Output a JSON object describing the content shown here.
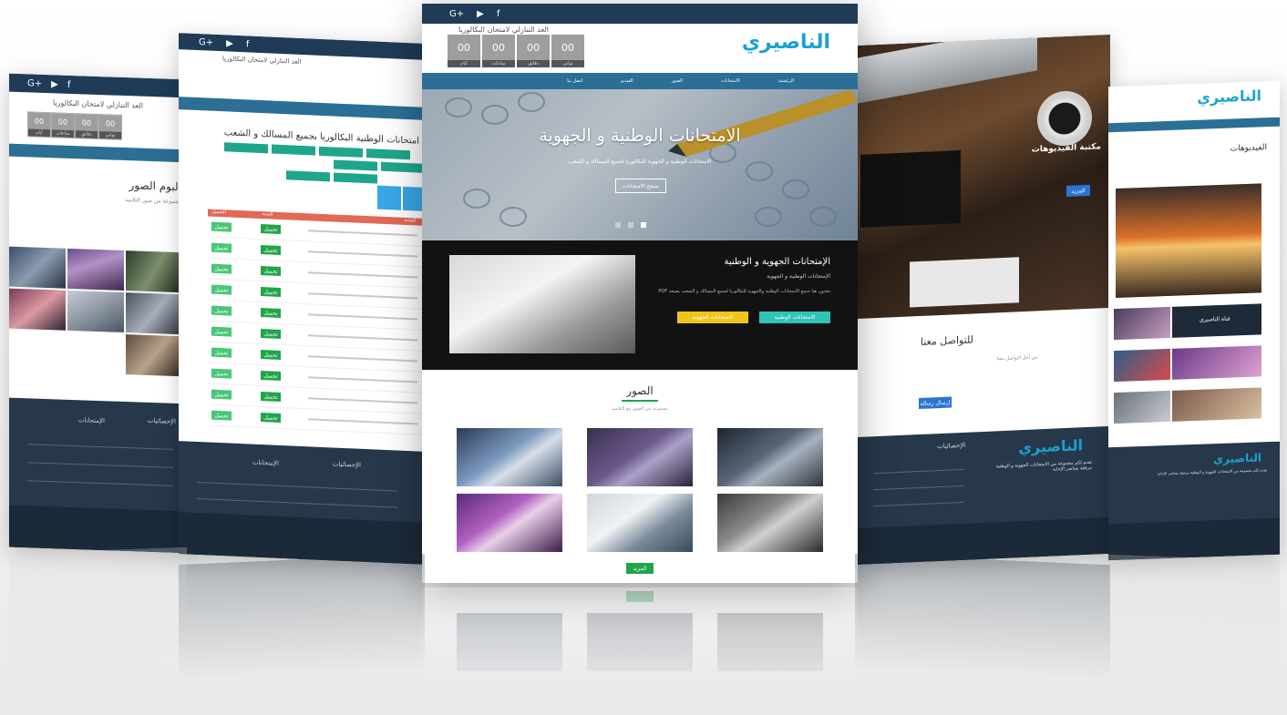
{
  "social": {
    "google": "G+",
    "youtube": "▶",
    "facebook": "f"
  },
  "logo": "الناصيري",
  "countdown": {
    "title": "العد التنازلي لامتحان البكالوريا",
    "values": [
      "00",
      "00",
      "00",
      "00"
    ],
    "labels": [
      "أيام",
      "ساعات",
      "دقائق",
      "ثواني"
    ]
  },
  "nav": [
    "الرئيسية",
    "الامتحانات",
    "الصور",
    "الفيديو",
    "اتصل بنا"
  ],
  "hero": {
    "title": "الامتحانات الوطنية و الجهوية",
    "text": "الامتحانات الوطنية و الجهوية للبكالوريا لجميع المسالك و الشعب",
    "button": "تصفح الامتحانات"
  },
  "exams": {
    "title": "الإمتحانات الجهوية و الوطنية",
    "subtitle": "الإمتحانات الوطنية و الجهوية",
    "desc": "تجدون هنا جميع الامتحانات الوطنية والجهوية للبكالوريا لجميع المسالك و الشعب بصيغة PDF",
    "btn_national": "الامتحانات الوطنية",
    "btn_regional": "الامتحانات الجهوية"
  },
  "photos": {
    "title": "الصور",
    "subtitle": "مجموعة من الصور مع التلاميذ",
    "more": "المزيد"
  },
  "album": {
    "title": "ألبوم الصور",
    "subtitle": "مجموعة من صور التلاميذ"
  },
  "exams_page": {
    "title": "امتحانات الوطنية البكالوريا بجميع المسالك و الشعب",
    "col_subject": "المادة",
    "col_year": "السنة",
    "col_download": "التحميل",
    "cell": "تحميل"
  },
  "videos": {
    "title": "مكتبة الفيديوهات",
    "more": "المزيد"
  },
  "contact": {
    "title": "للتواصل معنا",
    "text": "من أجل التواصل معنا",
    "button": "إرسال رسالة"
  },
  "footer": {
    "stats": "الإحصائيات",
    "exams": "الإمتحانات",
    "tagline": "نقدم لكم مجموعة من الامتحانات الجهوية و الوطنية مرفقة بعناصر الإجابة",
    "copy": "جميع الحقوق محفوظة"
  },
  "videos_right": {
    "title": "الفيديوهات",
    "label": "قناة الناصيري"
  },
  "colors": {
    "navy": "#1f3b57",
    "blue": "#2b6f96",
    "teal": "#2ec4b6",
    "yellow": "#f0c419",
    "green": "#1fa64a",
    "logo": "#1aa3cf"
  }
}
